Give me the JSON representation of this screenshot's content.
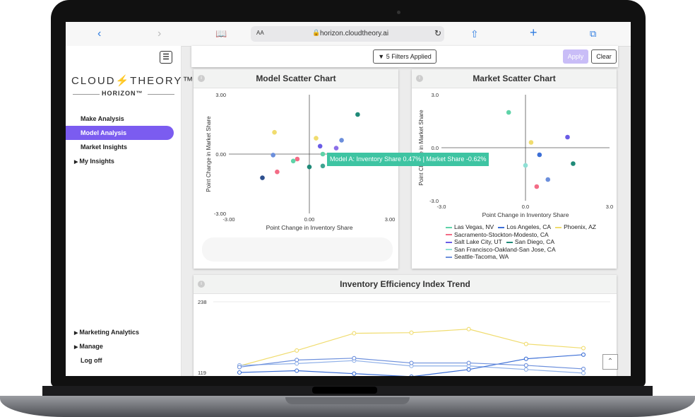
{
  "browser": {
    "aa_label": "AA",
    "url": "horizon.cloudtheory.ai",
    "back_icon": "chevron-left-icon",
    "forward_icon": "chevron-right-icon"
  },
  "sidebar": {
    "logo": "CLOUD⚡THEORY™",
    "sub_logo": "HORIZON™",
    "items": [
      {
        "label": "Make Analysis"
      },
      {
        "label": "Model Analysis"
      },
      {
        "label": "Market Insights"
      },
      {
        "label": "My Insights"
      },
      {
        "label": "Marketing Analytics"
      },
      {
        "label": "Manage"
      },
      {
        "label": "Log off"
      }
    ]
  },
  "filters": {
    "applied_label": "5 Filters Applied",
    "apply_label": "Apply",
    "clear_label": "Clear"
  },
  "model_scatter": {
    "title": "Model Scatter Chart",
    "tooltip": "Model A: Inventory Share 0.47% | Market Share -0.62%"
  },
  "market_scatter": {
    "title": "Market Scatter Chart"
  },
  "trend": {
    "title": "Inventory Efficiency Index Trend"
  },
  "colors": {
    "accent": "#7b5cf0",
    "las_vegas": "#5fd3a8",
    "los_angeles": "#3c6fd6",
    "phoenix": "#f0dc6e",
    "sacramento": "#f36c86",
    "salt_lake": "#6a5ce6",
    "san_diego": "#1f8a78",
    "san_francisco": "#8fe0d5",
    "seattle": "#6c8fdc"
  },
  "chart_data": [
    {
      "type": "scatter",
      "title": "Model Scatter Chart",
      "xlabel": "Point Change in Inventory Share",
      "ylabel": "Point Change in Market Share",
      "xlim": [
        -3.0,
        3.0
      ],
      "ylim": [
        -3.0,
        3.0
      ],
      "x_ticks": [
        "-3.00",
        "0.00",
        "3.00"
      ],
      "y_ticks": [
        "3.00",
        "0.00",
        "-3.00"
      ],
      "points": [
        {
          "x": 1.8,
          "y": 2.0,
          "color": "#1f8a78"
        },
        {
          "x": -1.3,
          "y": 1.1,
          "color": "#f0dc6e"
        },
        {
          "x": 0.25,
          "y": 0.8,
          "color": "#f0dc6e"
        },
        {
          "x": 1.2,
          "y": 0.7,
          "color": "#6c8fdc"
        },
        {
          "x": 0.4,
          "y": 0.4,
          "color": "#6a5ce6"
        },
        {
          "x": 1.0,
          "y": 0.3,
          "color": "#8b6fe8"
        },
        {
          "x": -1.35,
          "y": -0.05,
          "color": "#6c8fdc"
        },
        {
          "x": -0.45,
          "y": -0.25,
          "color": "#f36c86"
        },
        {
          "x": -0.6,
          "y": -0.35,
          "color": "#5fd3a8"
        },
        {
          "x": 0.5,
          "y": 0.0,
          "color": "#5fd3a8"
        },
        {
          "x": 0.0,
          "y": -0.65,
          "color": "#1f8a78"
        },
        {
          "x": 0.5,
          "y": -0.6,
          "color": "#3ea591"
        },
        {
          "x": -1.2,
          "y": -0.9,
          "color": "#f36c86"
        },
        {
          "x": -1.75,
          "y": -1.2,
          "color": "#2d4f8e"
        }
      ]
    },
    {
      "type": "scatter",
      "title": "Market Scatter Chart",
      "xlabel": "Point Change in Inventory Share",
      "ylabel": "Point Change in Market Share",
      "xlim": [
        -3.0,
        3.0
      ],
      "ylim": [
        -3.0,
        3.0
      ],
      "x_ticks": [
        "-3.0",
        "0.0",
        "3.0"
      ],
      "y_ticks": [
        "3.0",
        "0.0",
        "-3.0"
      ],
      "series": [
        {
          "name": "Las Vegas, NV",
          "color": "#5fd3a8",
          "x": -0.6,
          "y": 2.0
        },
        {
          "name": "Los Angeles, CA",
          "color": "#3c6fd6",
          "x": 0.5,
          "y": -0.4
        },
        {
          "name": "Phoenix, AZ",
          "color": "#f0dc6e",
          "x": 0.2,
          "y": 0.3
        },
        {
          "name": "Sacramento-Stockton-Modesto, CA",
          "color": "#f36c86",
          "x": 0.4,
          "y": -2.2
        },
        {
          "name": "Salt Lake City, UT",
          "color": "#6a5ce6",
          "x": 1.5,
          "y": 0.6
        },
        {
          "name": "San Diego, CA",
          "color": "#1f8a78",
          "x": 1.7,
          "y": -0.9
        },
        {
          "name": "San Francisco-Oakland-San Jose, CA",
          "color": "#8fe0d5",
          "x": 0.0,
          "y": -1.0
        },
        {
          "name": "Seattle-Tacoma, WA",
          "color": "#6c8fdc",
          "x": 0.8,
          "y": -1.8
        }
      ]
    },
    {
      "type": "line",
      "title": "Inventory Efficiency Index Trend",
      "y_ticks": [
        "238",
        "119"
      ],
      "ylim": [
        119,
        238
      ],
      "x_count": 7,
      "series": [
        {
          "color": "#f0dc6e",
          "values": [
            130,
            156,
            185,
            186,
            192,
            167,
            160
          ]
        },
        {
          "color": "#8fb0e8",
          "values": [
            131,
            134,
            139,
            130,
            130,
            124,
            118
          ]
        },
        {
          "color": "#3c6fd6",
          "values": [
            119,
            122,
            117,
            112,
            124,
            142,
            149
          ]
        },
        {
          "color": "#6c8fdc",
          "values": [
            128,
            140,
            143,
            135,
            135,
            131,
            125
          ]
        }
      ]
    }
  ]
}
